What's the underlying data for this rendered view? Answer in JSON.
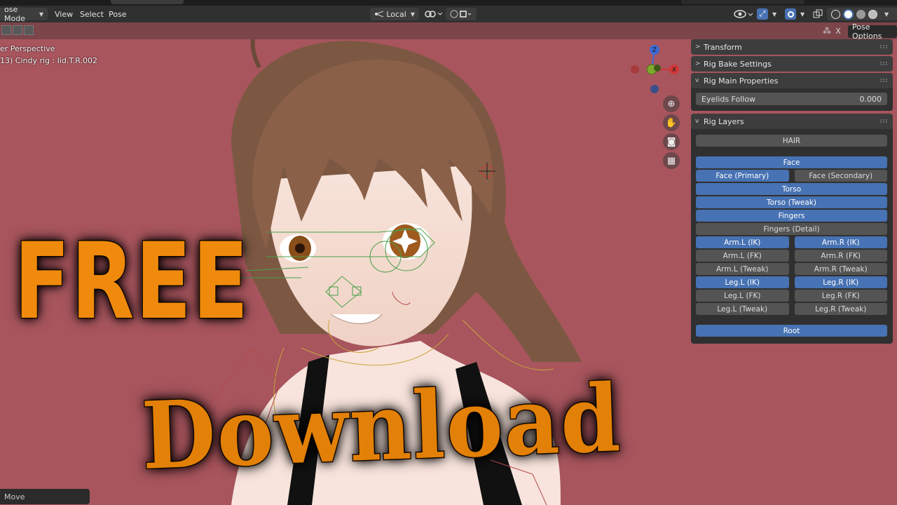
{
  "header": {
    "mode": "ose Mode",
    "menus": [
      "View",
      "Select",
      "Pose"
    ],
    "pivot": "Local"
  },
  "toolbar2": {
    "close_label": "X",
    "pose_options": "Pose Options"
  },
  "viewport": {
    "view_name": "er Perspective",
    "active": "13) Cindy rig : lid.T.R.002",
    "gizmo_z": "Z",
    "gizmo_x": "X"
  },
  "npanel": {
    "transform": "Transform",
    "rig_bake": "Rig Bake Settings",
    "rig_main": "Rig Main Properties",
    "eyelids_label": "Eyelids Follow",
    "eyelids_value": "0.000",
    "rig_layers": "Rig Layers",
    "layers": {
      "hair": "HAIR",
      "face": "Face",
      "face_primary": "Face (Primary)",
      "face_secondary": "Face (Secondary)",
      "torso": "Torso",
      "torso_tweak": "Torso (Tweak)",
      "fingers": "Fingers",
      "fingers_detail": "Fingers (Detail)",
      "arm_l_ik": "Arm.L (IK)",
      "arm_r_ik": "Arm.R (IK)",
      "arm_l_fk": "Arm.L (FK)",
      "arm_r_fk": "Arm.R (FK)",
      "arm_l_tweak": "Arm.L (Tweak)",
      "arm_r_tweak": "Arm.R (Tweak)",
      "leg_l_ik": "Leg.L (IK)",
      "leg_r_ik": "Leg.R (IK)",
      "leg_l_fk": "Leg.L (FK)",
      "leg_r_fk": "Leg.R (FK)",
      "leg_l_tweak": "Leg.L (Tweak)",
      "leg_r_tweak": "Leg.R (Tweak)",
      "root": "Root"
    }
  },
  "status": {
    "last_op": "Move"
  },
  "overlay": {
    "free": "FREE",
    "download": "Download"
  },
  "colors": {
    "background": "#a8555d",
    "accent_blue": "#4772b3",
    "title_orange": "#f08a0c"
  }
}
